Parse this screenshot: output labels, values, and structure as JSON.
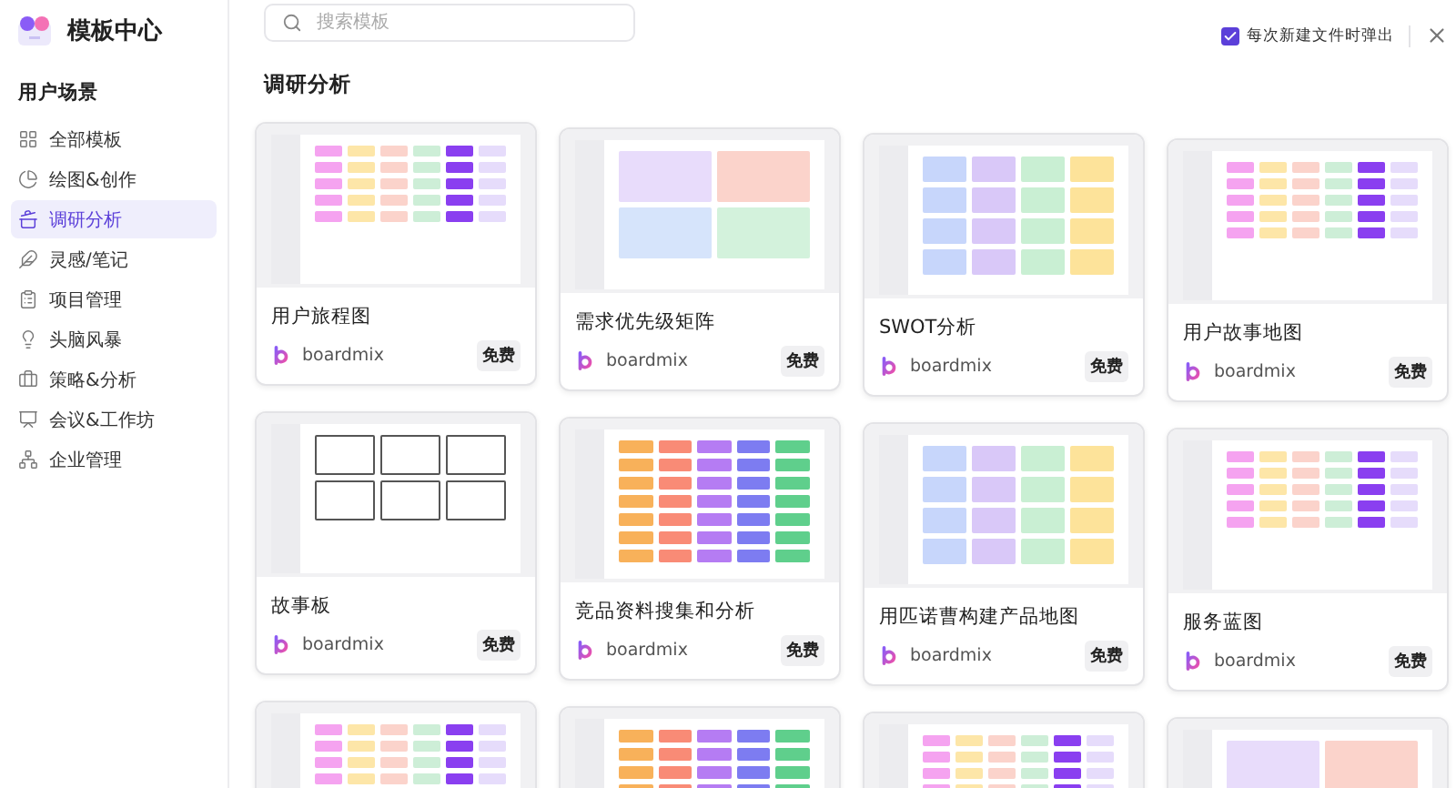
{
  "app": {
    "title": "模板中心"
  },
  "sidebar": {
    "section": "用户场景",
    "items": [
      {
        "label": "全部模板",
        "selected": false
      },
      {
        "label": "绘图&创作",
        "selected": false
      },
      {
        "label": "调研分析",
        "selected": true
      },
      {
        "label": "灵感/笔记",
        "selected": false
      },
      {
        "label": "项目管理",
        "selected": false
      },
      {
        "label": "头脑风暴",
        "selected": false
      },
      {
        "label": "策略&分析",
        "selected": false
      },
      {
        "label": "会议&工作坊",
        "selected": false
      },
      {
        "label": "企业管理",
        "selected": false
      }
    ]
  },
  "search": {
    "placeholder": "搜索模板"
  },
  "popup_option": {
    "label": "每次新建文件时弹出",
    "checked": true
  },
  "section_title": "调研分析",
  "cards": [
    {
      "kind": "rows",
      "title": "用户旅程图",
      "brand": "boardmix",
      "badge": "免费"
    },
    {
      "kind": "matrix",
      "title": "需求优先级矩阵",
      "brand": "boardmix",
      "badge": "免费"
    },
    {
      "kind": "quadrants",
      "title": "SWOT分析",
      "brand": "boardmix",
      "badge": "免费"
    },
    {
      "kind": "rows",
      "title": "用户故事地图",
      "brand": "boardmix",
      "badge": "免费"
    },
    {
      "kind": "sketch",
      "title": "故事板",
      "brand": "boardmix",
      "badge": "免费"
    },
    {
      "kind": "columns",
      "title": "竞品资料搜集和分析",
      "brand": "boardmix",
      "badge": "免费"
    },
    {
      "kind": "quadrants",
      "title": "用匹诺曹构建产品地图",
      "brand": "boardmix",
      "badge": "免费"
    },
    {
      "kind": "rows",
      "title": "服务蓝图",
      "brand": "boardmix",
      "badge": "免费"
    },
    {
      "kind": "rows"
    },
    {
      "kind": "columns"
    },
    {
      "kind": "rows"
    },
    {
      "kind": "matrix"
    }
  ]
}
